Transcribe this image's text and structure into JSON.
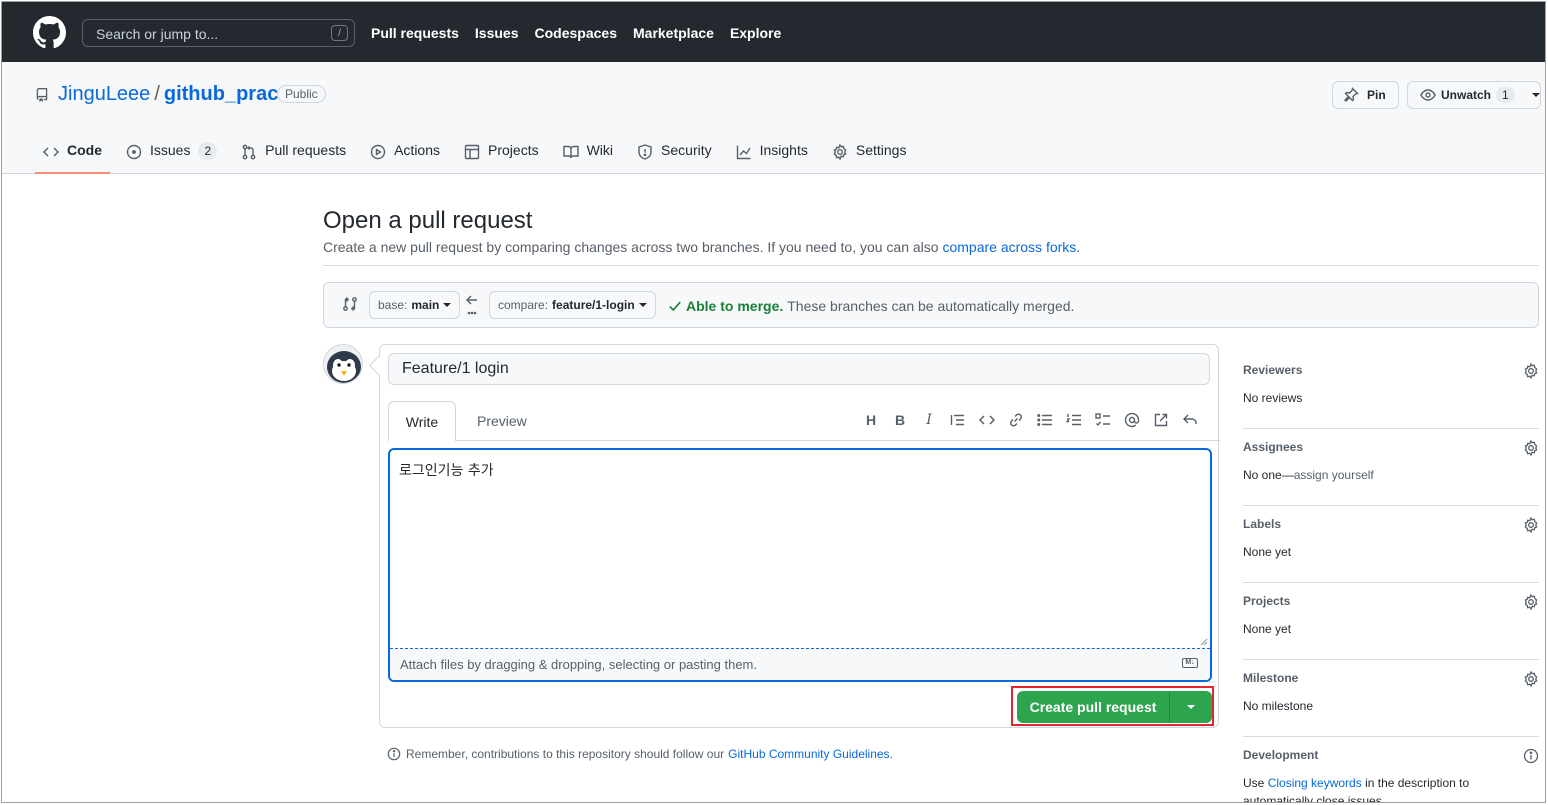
{
  "topbar": {
    "search_placeholder": "Search or jump to...",
    "search_shortcut": "/",
    "nav": [
      "Pull requests",
      "Issues",
      "Codespaces",
      "Marketplace",
      "Explore"
    ]
  },
  "repo": {
    "owner": "JinguLeee",
    "separator": "/",
    "name": "github_prac",
    "visibility": "Public",
    "pin_label": "Pin",
    "unwatch_label": "Unwatch",
    "watch_count": "1",
    "tabs": [
      {
        "label": "Code",
        "icon": "code-icon"
      },
      {
        "label": "Issues",
        "icon": "issue-icon",
        "count": "2"
      },
      {
        "label": "Pull requests",
        "icon": "pull-request-icon"
      },
      {
        "label": "Actions",
        "icon": "play-icon"
      },
      {
        "label": "Projects",
        "icon": "table-icon"
      },
      {
        "label": "Wiki",
        "icon": "book-icon"
      },
      {
        "label": "Security",
        "icon": "shield-icon"
      },
      {
        "label": "Insights",
        "icon": "graph-icon"
      },
      {
        "label": "Settings",
        "icon": "gear-icon"
      }
    ]
  },
  "page": {
    "title": "Open a pull request",
    "subtitle": "Create a new pull request by comparing changes across two branches. If you need to, you can also",
    "subtitle_link": "compare across forks."
  },
  "compare": {
    "base_prefix": "base:",
    "base_branch": "main",
    "compare_prefix": "compare:",
    "compare_branch": "feature/1-login",
    "merge_status": "Able to merge.",
    "merge_desc": "These branches can be automatically merged."
  },
  "form": {
    "title_value": "Feature/1 login",
    "tab_write": "Write",
    "tab_preview": "Preview",
    "toolbar": [
      "heading-icon",
      "bold-icon",
      "italic-icon",
      "quote-icon",
      "code-icon",
      "link-icon",
      "bullet-list-icon",
      "numbered-list-icon",
      "task-list-icon",
      "mention-icon",
      "reference-icon",
      "reply-icon"
    ],
    "body_value": "로그인기능 추가",
    "attach_hint": "Attach files by dragging & dropping, selecting or pasting them.",
    "markdown_badge": "M↓",
    "create_label": "Create pull request"
  },
  "remember": {
    "text": "Remember, contributions to this repository should follow our",
    "link": "GitHub Community Guidelines",
    "tail": "."
  },
  "sidebar": [
    {
      "title": "Reviewers",
      "value": "No reviews"
    },
    {
      "title": "Assignees",
      "value": "No one—",
      "value_extra": "assign yourself"
    },
    {
      "title": "Labels",
      "value": "None yet"
    },
    {
      "title": "Projects",
      "value": "None yet"
    },
    {
      "title": "Milestone",
      "value": "No milestone"
    },
    {
      "title": "Development",
      "value": "Use ",
      "link": "Closing keywords",
      "value_extra": " in the description to automatically close issues"
    }
  ],
  "colors": {
    "header_bg": "#24292f",
    "accent_blue": "#0969da",
    "success_green": "#2da44e",
    "highlight_red": "#e3262f",
    "tab_underline": "#fd8c73"
  }
}
